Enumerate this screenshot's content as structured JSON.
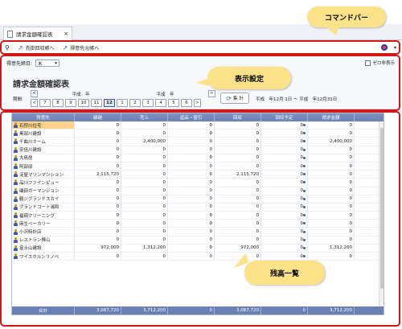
{
  "tab": {
    "title": "請求金額確認表",
    "close": "×"
  },
  "commandbar": {
    "items": [
      {
        "label": "売掛回収帳へ"
      },
      {
        "label": "得意先元帳へ"
      }
    ]
  },
  "settings": {
    "cutoff_label": "得意先締日:",
    "cutoff_value": "末",
    "hide_zero_label": "ゼロ非表示",
    "title": "請求金額確認表",
    "period_label": "期間:",
    "year_left": "平成　年",
    "year_right": "平成　年",
    "months": [
      "7",
      "8",
      "9",
      "10",
      "11",
      "12",
      "1",
      "2",
      "3",
      "4",
      "5",
      "6"
    ],
    "active_month": "12",
    "calc_label": "集 計",
    "range": "平成　年12月 1日 ～ 平成　年12月31日"
  },
  "table": {
    "headers": [
      "得意先",
      "繰越",
      "売上",
      "返品・値引",
      "回収",
      "回収予定",
      "請求金額"
    ],
    "rows": [
      [
        "石狩川住宅",
        "0",
        "0",
        "0",
        "0",
        "0",
        "0"
      ],
      [
        "黒部川建設",
        "0",
        "0",
        "0",
        "0",
        "0",
        "0"
      ],
      [
        "千曲川ホーム",
        "0",
        "2,400,000",
        "0",
        "0",
        "0",
        "2,400,000"
      ],
      [
        "安倍川建設",
        "0",
        "0",
        "0",
        "0",
        "0",
        "0"
      ],
      [
        "大鳥居",
        "0",
        "0",
        "0",
        "0",
        "0",
        "0"
      ],
      [
        "阿部邸",
        "0",
        "0",
        "0",
        "0",
        "0",
        "0"
      ],
      [
        "淀屋マリンマンション",
        "2,115,720",
        "0",
        "0",
        "2,115,720",
        "0",
        "0"
      ],
      [
        "品川ファインピュー",
        "0",
        "0",
        "0",
        "0",
        "0",
        "0"
      ],
      [
        "磯田ガーマンション",
        "0",
        "0",
        "0",
        "0",
        "0",
        "0"
      ],
      [
        "鶴ジグランドスカイ",
        "0",
        "0",
        "0",
        "0",
        "0",
        "0"
      ],
      [
        "グランドコート浦和",
        "0",
        "0",
        "0",
        "0",
        "0",
        "0"
      ],
      [
        "福田クリーニング",
        "0",
        "0",
        "0",
        "0",
        "0",
        "0"
      ],
      [
        "麻生ベーカリー",
        "0",
        "0",
        "0",
        "0",
        "0",
        "0"
      ],
      [
        "小沢時計店",
        "0",
        "0",
        "0",
        "0",
        "0",
        "0"
      ],
      [
        "レストラン棒山",
        "0",
        "0",
        "0",
        "0",
        "0",
        "0"
      ],
      [
        "富士山建設",
        "972,000",
        "1,312,200",
        "0",
        "972,000",
        "0",
        "1,312,200"
      ],
      [
        "ワイスホルンリノベ",
        "0",
        "0",
        "0",
        "0",
        "0",
        "0"
      ]
    ],
    "total": [
      "合計",
      "3,087,720",
      "3,712,200",
      "0",
      "3,087,720",
      "0",
      "3,712,200"
    ]
  },
  "callouts": {
    "command": "コマンドバー",
    "display": "表示設定",
    "balance": "残高一覧"
  },
  "colors": {
    "accent": "#6b80b3",
    "highlight": "#d01818",
    "callout": "#fce38a"
  }
}
